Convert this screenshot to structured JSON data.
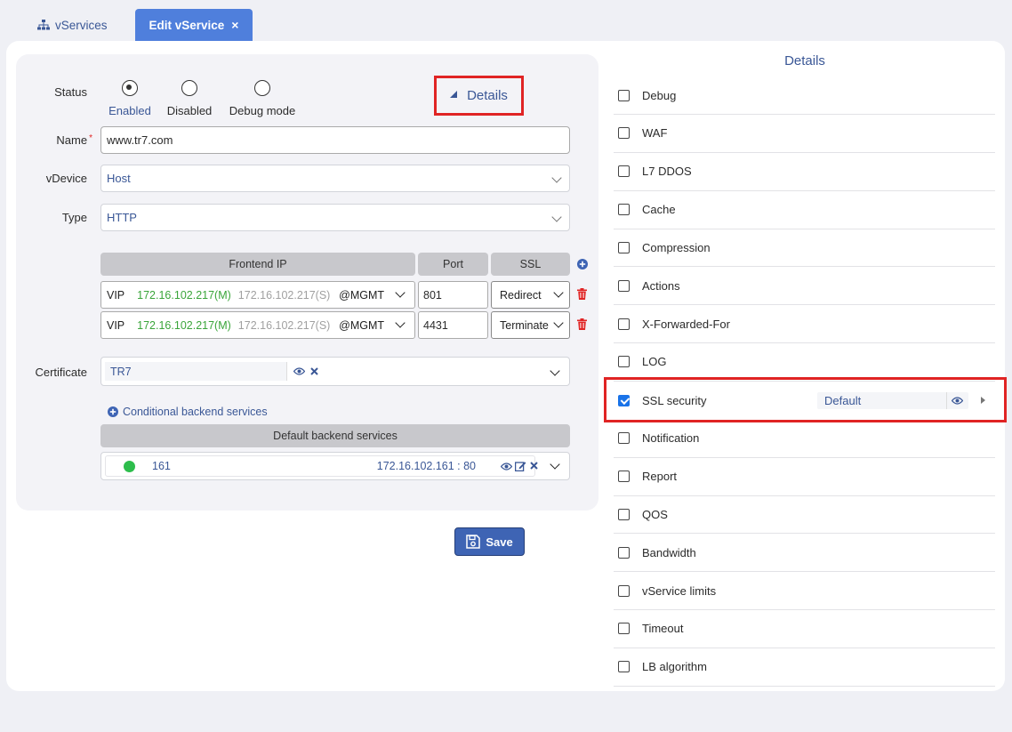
{
  "tabs": {
    "vservices": "vServices",
    "edit": "Edit vService",
    "close": "×"
  },
  "form": {
    "status_label": "Status",
    "status_options": [
      "Enabled",
      "Disabled",
      "Debug mode"
    ],
    "status_selected": "Enabled",
    "details_button": "Details",
    "name_label": "Name",
    "name_required": "*",
    "name_value": "www.tr7.com",
    "vdevice_label": "vDevice",
    "vdevice_value": "Host",
    "type_label": "Type",
    "type_value": "HTTP",
    "frontend": {
      "headers": [
        "Frontend IP",
        "Port",
        "SSL"
      ],
      "rows": [
        {
          "kind": "VIP",
          "ip_m": "172.16.102.217(M)",
          "ip_s": "172.16.102.217(S)",
          "iface": "@MGMT",
          "port": "801",
          "ssl": "Redirect"
        },
        {
          "kind": "VIP",
          "ip_m": "172.16.102.217(M)",
          "ip_s": "172.16.102.217(S)",
          "iface": "@MGMT",
          "port": "4431",
          "ssl": "Terminate"
        }
      ]
    },
    "certificate_label": "Certificate",
    "certificate_value": "TR7",
    "conditional_link": "Conditional backend services",
    "default_backend_header": "Default backend services",
    "backend": {
      "name": "161",
      "address": "172.16.102.161 : 80",
      "status_color": "#2dbd4c"
    },
    "save_label": "Save"
  },
  "details": {
    "title": "Details",
    "options": [
      {
        "label": "Debug",
        "checked": false
      },
      {
        "label": "WAF",
        "checked": false
      },
      {
        "label": "L7 DDOS",
        "checked": false
      },
      {
        "label": "Cache",
        "checked": false
      },
      {
        "label": "Compression",
        "checked": false
      },
      {
        "label": "Actions",
        "checked": false
      },
      {
        "label": "X-Forwarded-For",
        "checked": false
      },
      {
        "label": "LOG",
        "checked": false
      },
      {
        "label": "SSL security",
        "checked": true
      },
      {
        "label": "Notification",
        "checked": false
      },
      {
        "label": "Report",
        "checked": false
      },
      {
        "label": "QOS",
        "checked": false
      },
      {
        "label": "Bandwidth",
        "checked": false
      },
      {
        "label": "vService limits",
        "checked": false
      },
      {
        "label": "Timeout",
        "checked": false
      },
      {
        "label": "LB algorithm",
        "checked": false
      }
    ],
    "ssl_security_profile": "Default"
  },
  "colors": {
    "accent": "#4f7fdc",
    "link": "#3a5796",
    "highlight": "#e02424",
    "delete": "#e02424"
  }
}
